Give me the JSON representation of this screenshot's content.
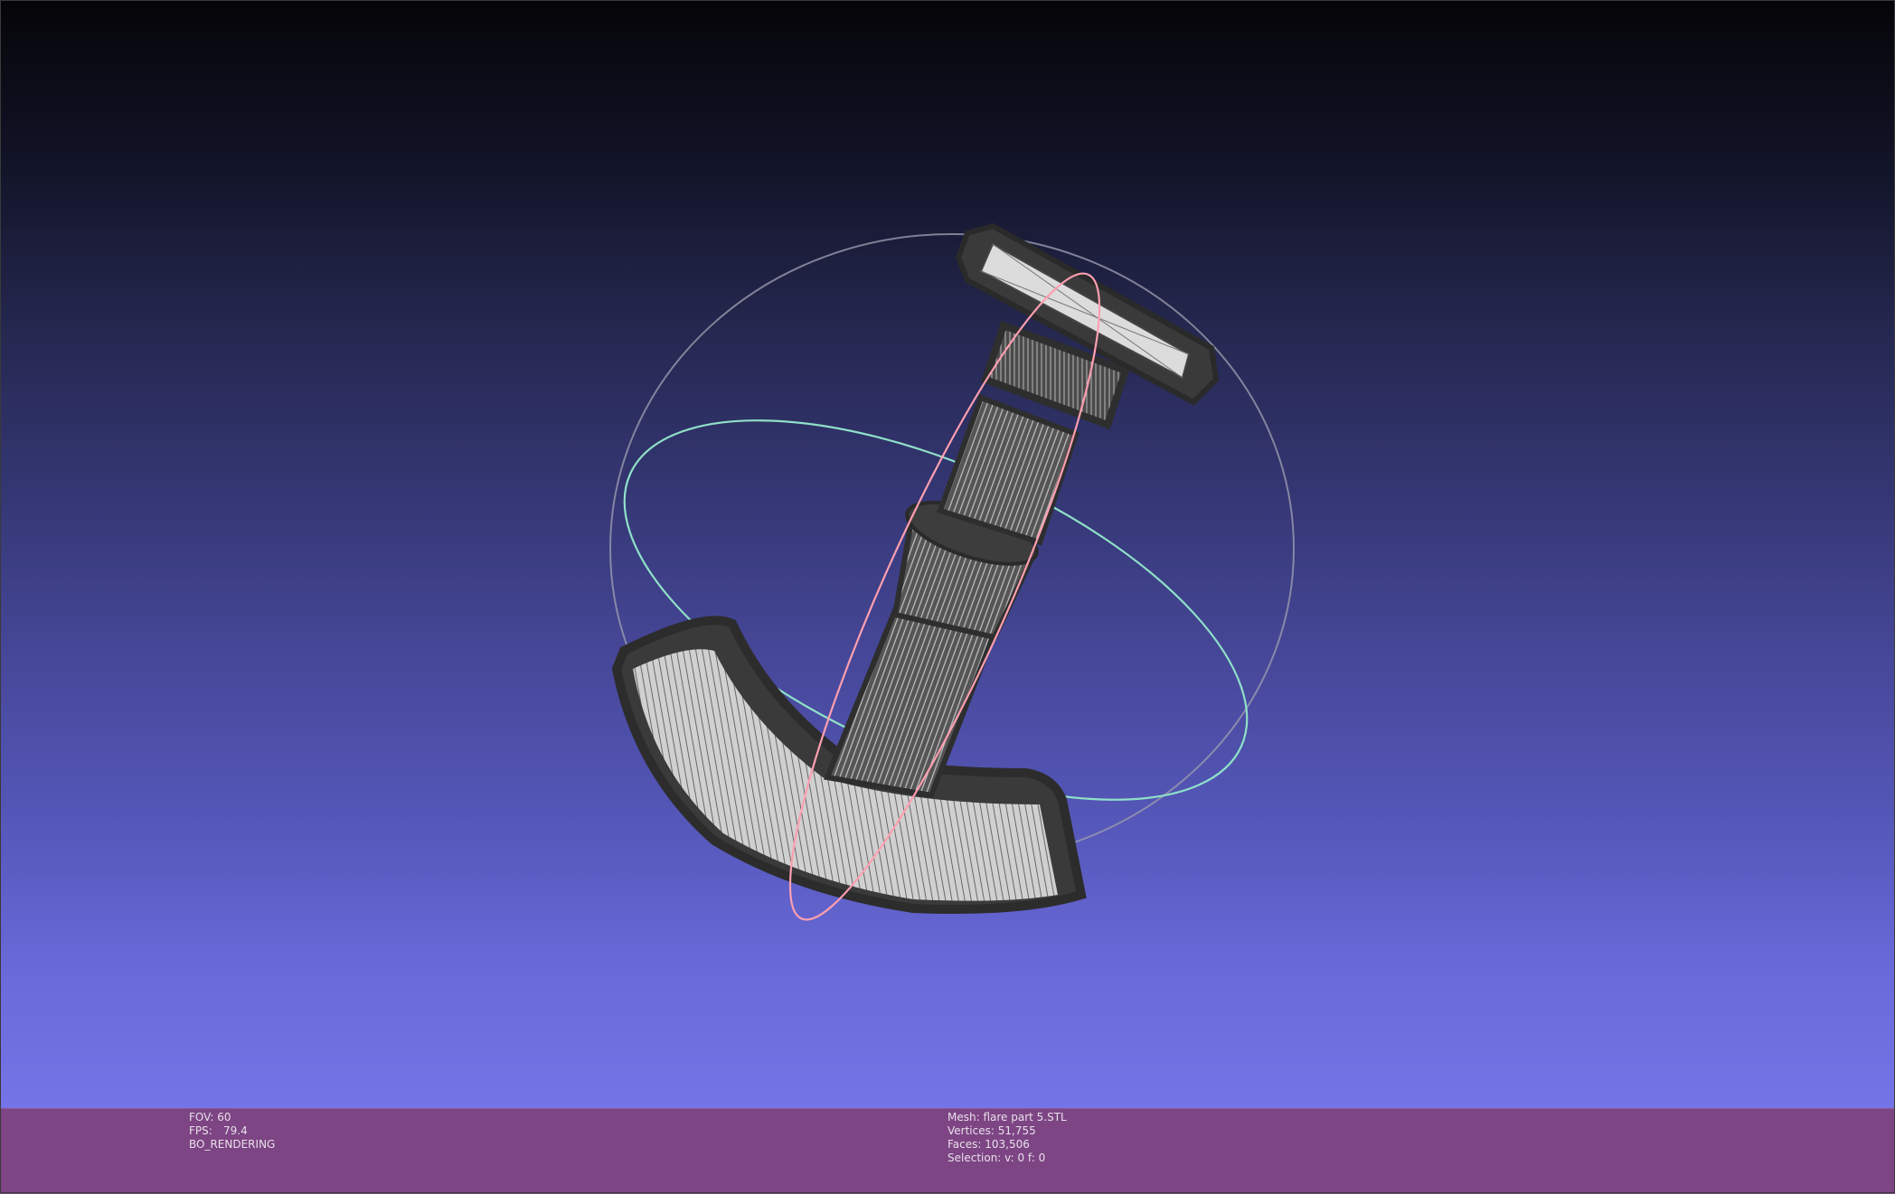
{
  "viewport": {
    "background_top": "#050508",
    "background_bottom": "#7574e6",
    "trackball": {
      "sphere_color": "#9a9aae",
      "horizontal_ring_color": "#8fe0c8",
      "vertical_ring_color": "#ff9fb0"
    },
    "mesh_icon": "mesh-3d-model"
  },
  "status_left": {
    "fov": "FOV: 60",
    "fps_label": "FPS:",
    "fps_value": "79.4",
    "render_mode": "BO_RENDERING"
  },
  "status_right": {
    "mesh": "Mesh: flare part 5.STL",
    "vertices": "Vertices: 51,755",
    "faces": "Faces: 103,506",
    "selection": "Selection: v: 0 f: 0"
  },
  "status_bar_color": "#7d4584"
}
